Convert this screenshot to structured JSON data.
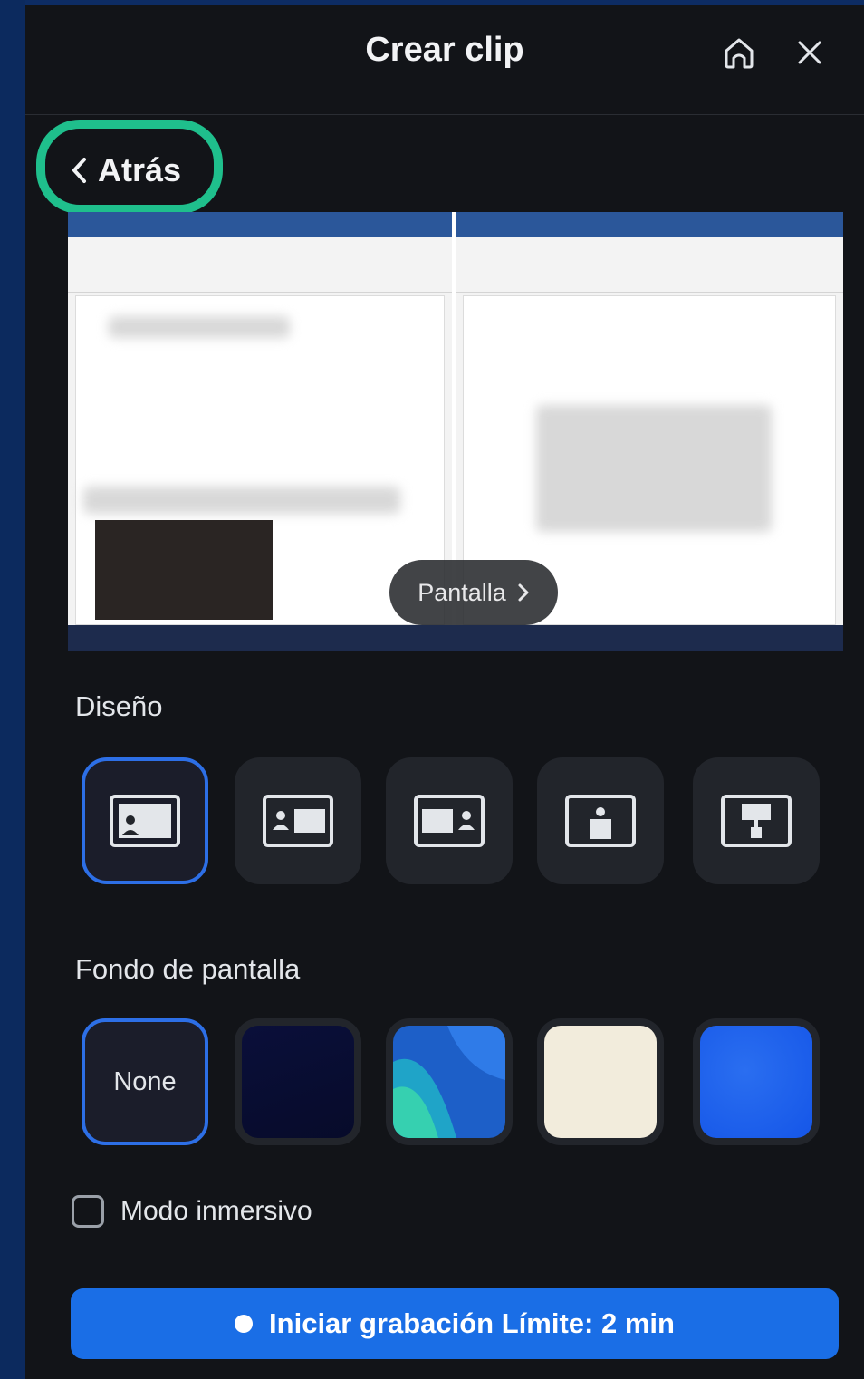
{
  "header": {
    "title": "Crear clip"
  },
  "back": {
    "label": "Atrás"
  },
  "preview": {
    "source_label": "Pantalla"
  },
  "layout": {
    "label": "Diseño",
    "options": [
      {
        "icon": "layout-speaker-left-icon",
        "selected": true
      },
      {
        "icon": "layout-side-by-side-left-icon",
        "selected": false
      },
      {
        "icon": "layout-side-by-side-right-icon",
        "selected": false
      },
      {
        "icon": "layout-speaker-center-icon",
        "selected": false
      },
      {
        "icon": "layout-presentation-icon",
        "selected": false
      }
    ]
  },
  "background": {
    "label": "Fondo de pantalla",
    "options": [
      {
        "label": "None",
        "color": "#1b1d2a",
        "selected": true
      },
      {
        "color": "#0a0f3a",
        "selected": false
      },
      {
        "color": "#1d5fc8",
        "selected": false
      },
      {
        "color": "#f2ecdc",
        "selected": false
      },
      {
        "color": "#1556e8",
        "selected": false
      }
    ]
  },
  "immersive": {
    "label": "Modo inmersivo",
    "checked": false
  },
  "record": {
    "label": "Iniciar grabación Límite: 2 min"
  },
  "colors": {
    "accent": "#1a6ee6",
    "highlight": "#1fbf8c",
    "panel": "#121418"
  }
}
